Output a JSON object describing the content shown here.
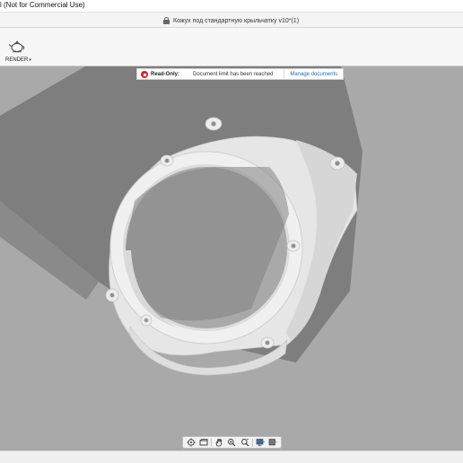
{
  "window": {
    "title": "l (Not for Commercial Use)"
  },
  "document": {
    "title": "Кожух под стандартную крыльчатку v10*(1)"
  },
  "toolbar": {
    "render_label": "RENDER"
  },
  "banner": {
    "label": "Read-Only:",
    "message": "Document limit has been reached",
    "link": "Manage documents"
  },
  "navbar": {
    "tools": [
      "orbit-icon",
      "look-at-icon",
      "pan-hand-icon",
      "zoom-fit-icon",
      "zoom-icon",
      "display-settings-icon",
      "grid-settings-icon"
    ]
  },
  "colors": {
    "viewport_bg": "#a9a9a9",
    "shadow": "#7c7c7c",
    "model": "#ececec",
    "banner_warning": "#d3262e",
    "link": "#1a6fb5"
  }
}
